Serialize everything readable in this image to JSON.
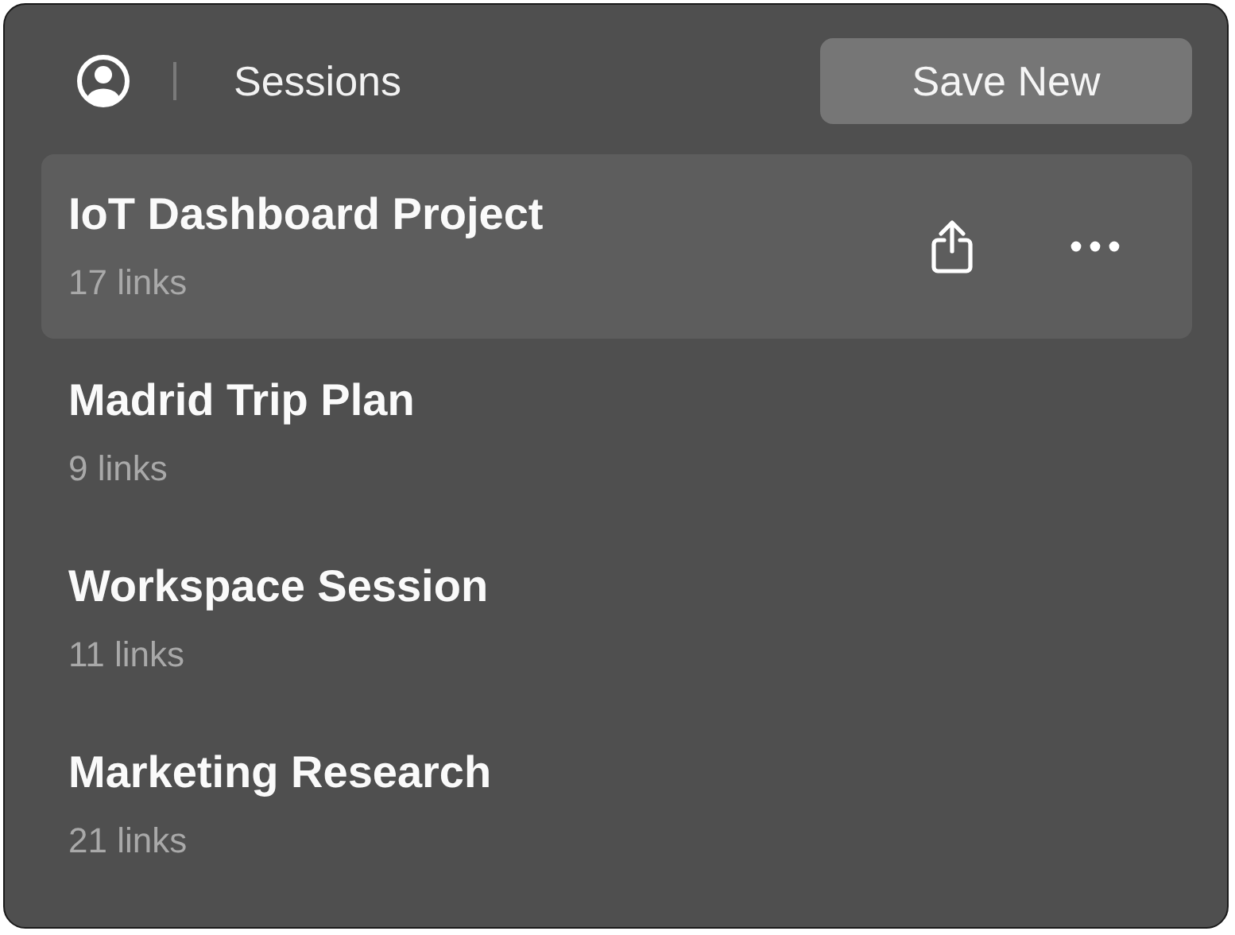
{
  "header": {
    "title": "Sessions",
    "button": "Save New"
  },
  "sessions": [
    {
      "name": "IoT Dashboard Project",
      "count": "17 links",
      "selected": true
    },
    {
      "name": "Madrid Trip Plan",
      "count": "9 links",
      "selected": false
    },
    {
      "name": "Workspace Session",
      "count": "11 links",
      "selected": false
    },
    {
      "name": "Marketing Research",
      "count": "21 links",
      "selected": false
    }
  ]
}
